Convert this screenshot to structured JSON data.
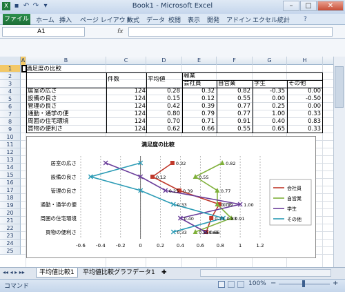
{
  "window": {
    "title": "Book1 - Microsoft Excel",
    "min": "–",
    "max": "□",
    "close": "✕"
  },
  "quick_access": [
    "▪",
    "↶",
    "↷",
    "▾"
  ],
  "ribbon": {
    "file": "ファイル",
    "tabs": [
      "ホーム",
      "挿入",
      "ページ レイアウト",
      "数式",
      "データ",
      "校閲",
      "表示",
      "開発",
      "アドイン",
      "エクセル統計"
    ]
  },
  "formula_bar": {
    "name_box": "A1",
    "fx": "fx",
    "value": ""
  },
  "columns": [
    "A",
    "B",
    "C",
    "D",
    "E",
    "F",
    "G",
    "H"
  ],
  "rows": [
    "1",
    "2",
    "3",
    "4",
    "5",
    "6",
    "7",
    "8",
    "9",
    "10",
    "11",
    "12",
    "13",
    "14",
    "15",
    "16",
    "17",
    "18",
    "19",
    "20",
    "21",
    "22",
    "23",
    "24",
    "25"
  ],
  "sheet": {
    "title": "満足度の比較",
    "header_count": "件数",
    "header_mean": "平均値",
    "header_group": "職業",
    "sub_headers": [
      "会社員",
      "自営業",
      "学生",
      "その他"
    ],
    "data_rows": [
      {
        "label": "居室の広さ",
        "count": "124",
        "mean": "0.28",
        "vals": [
          "0.32",
          "0.82",
          "-0.35",
          "0.00"
        ]
      },
      {
        "label": "設備の良さ",
        "count": "124",
        "mean": "0.15",
        "vals": [
          "0.12",
          "0.55",
          "0.00",
          "-0.50"
        ]
      },
      {
        "label": "管理の良さ",
        "count": "124",
        "mean": "0.42",
        "vals": [
          "0.39",
          "0.77",
          "0.25",
          "0.00"
        ]
      },
      {
        "label": "通勤・通学の便",
        "count": "124",
        "mean": "0.80",
        "vals": [
          "0.79",
          "0.77",
          "1.00",
          "0.33"
        ]
      },
      {
        "label": "周囲の住宅環境",
        "count": "124",
        "mean": "0.70",
        "vals": [
          "0.71",
          "0.91",
          "0.40",
          "0.83"
        ]
      },
      {
        "label": "買物の便利さ",
        "count": "124",
        "mean": "0.62",
        "vals": [
          "0.66",
          "0.55",
          "0.65",
          "0.33"
        ]
      }
    ]
  },
  "chart_data": {
    "type": "line",
    "title": "満足度の比較",
    "categories": [
      "居室の広さ",
      "設備の良さ",
      "管理の良さ",
      "通勤・通学の便",
      "周囲の住宅環境",
      "買物の便利さ"
    ],
    "xlim": [
      -0.6,
      1.2
    ],
    "x_ticks": [
      "-0.6",
      "-0.4",
      "-0.2",
      "0",
      "0.2",
      "0.4",
      "0.6",
      "0.8",
      "1",
      "1.2"
    ],
    "grid": "vertical",
    "legend_position": "right",
    "series": [
      {
        "name": "会社員",
        "color": "#c0392b",
        "marker": "square",
        "values": [
          0.32,
          0.12,
          0.39,
          0.79,
          0.71,
          0.66
        ]
      },
      {
        "name": "自営業",
        "color": "#7fb03a",
        "marker": "triangle",
        "values": [
          0.82,
          0.55,
          0.77,
          0.77,
          0.91,
          0.55
        ]
      },
      {
        "name": "学生",
        "color": "#6a3d9a",
        "marker": "x",
        "values": [
          -0.35,
          0.0,
          0.25,
          1.0,
          0.4,
          0.65
        ]
      },
      {
        "name": "その他",
        "color": "#2b9bb5",
        "marker": "x",
        "values": [
          0.0,
          -0.5,
          0.0,
          0.33,
          0.83,
          0.33
        ]
      }
    ],
    "data_labels": [
      {
        "series": 0,
        "row": 0,
        "text": "0.32"
      },
      {
        "series": 0,
        "row": 1,
        "text": "0.12"
      },
      {
        "series": 0,
        "row": 2,
        "text": "0.39"
      },
      {
        "series": 0,
        "row": 3,
        "text": "0.79"
      },
      {
        "series": 0,
        "row": 4,
        "text": "0.71"
      },
      {
        "series": 0,
        "row": 5,
        "text": "0.66"
      },
      {
        "series": 1,
        "row": 0,
        "text": "0.82"
      },
      {
        "series": 1,
        "row": 1,
        "text": "0.55"
      },
      {
        "series": 1,
        "row": 2,
        "text": "0.77"
      },
      {
        "series": 1,
        "row": 3,
        "text": "0.77"
      },
      {
        "series": 1,
        "row": 4,
        "text": "0.91"
      },
      {
        "series": 1,
        "row": 5,
        "text": "0.55"
      },
      {
        "series": 2,
        "row": 2,
        "text": "0.25"
      },
      {
        "series": 2,
        "row": 3,
        "text": "1.00"
      },
      {
        "series": 2,
        "row": 4,
        "text": "0.40"
      },
      {
        "series": 2,
        "row": 5,
        "text": "0.65"
      },
      {
        "series": 3,
        "row": 3,
        "text": "0.33"
      },
      {
        "series": 3,
        "row": 4,
        "text": "0.83"
      },
      {
        "series": 3,
        "row": 5,
        "text": "0.33"
      }
    ]
  },
  "sheet_tabs": [
    "平均値比較1",
    "平均値比較グラフデータ1"
  ],
  "status": {
    "mode": "コマンド",
    "zoom": "100%",
    "minus": "−",
    "plus": "+"
  }
}
